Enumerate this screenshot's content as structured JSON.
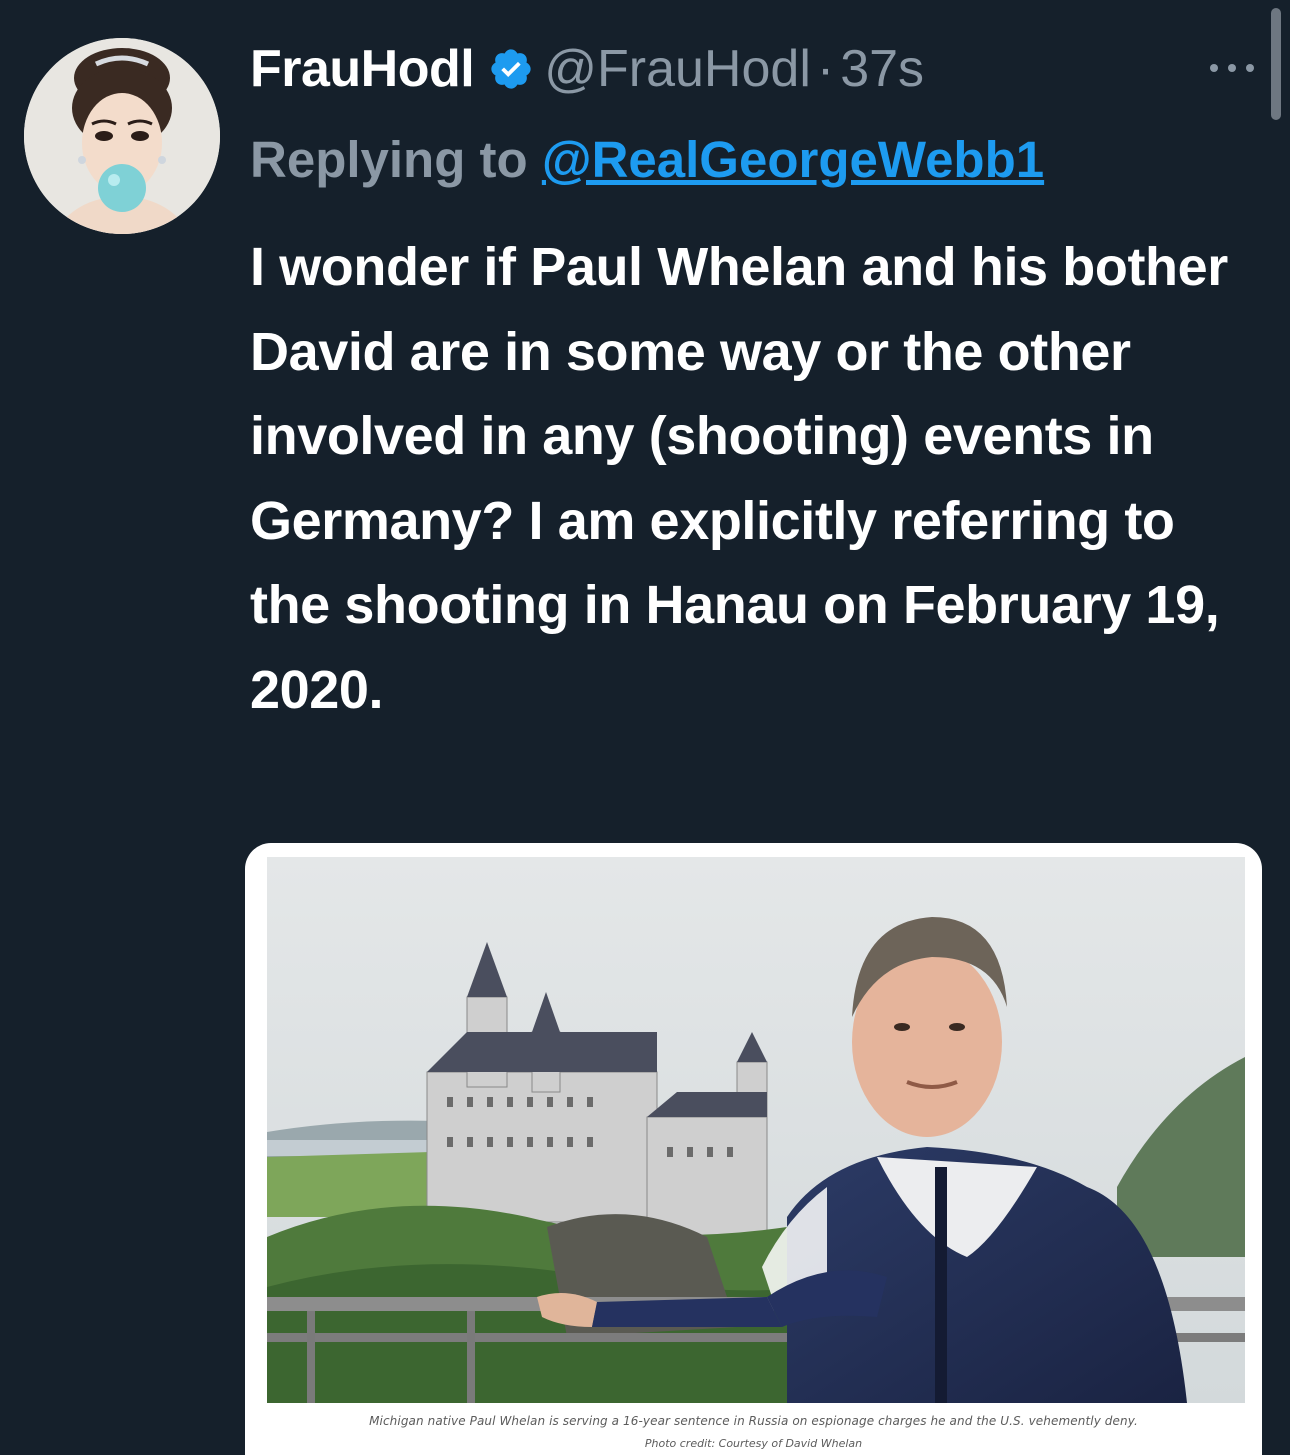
{
  "tweet": {
    "display_name": "FrauHodl",
    "handle": "@FrauHodl",
    "separator": "·",
    "timestamp": "37s",
    "verified_icon": "verified-badge-icon",
    "more_icon": "more-options-icon",
    "reply_prefix": "Replying to ",
    "reply_mention": "@RealGeorgeWebb1",
    "body": "I wonder if Paul Whelan and his bother David are in some way or the other involved in any (shooting) events in Germany? I am explicitly referring to the shooting in Hanau on February 19, 2020."
  },
  "media": {
    "caption": "Michigan native Paul Whelan is serving a 16-year sentence in Russia on espionage charges he and the U.S. vehemently deny.",
    "credit": "Photo credit: Courtesy of David Whelan"
  },
  "colors": {
    "background": "#15202b",
    "text_primary": "#ffffff",
    "text_secondary": "#8b98a5",
    "link": "#1d9bf0",
    "verified": "#1d9bf0"
  }
}
